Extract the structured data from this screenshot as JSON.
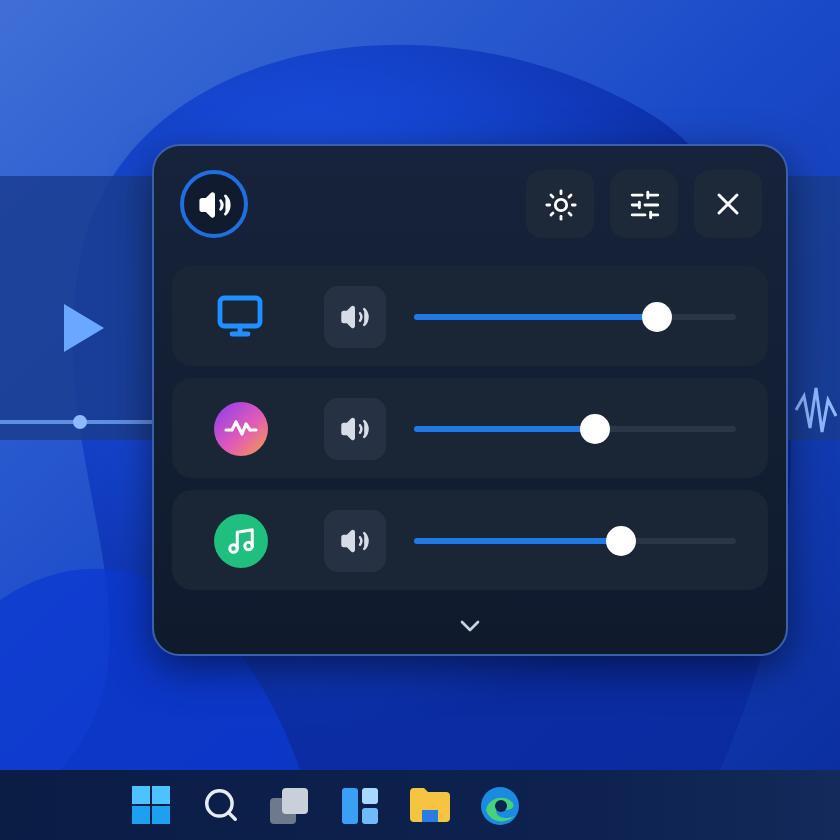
{
  "channels": [
    {
      "kind": "display",
      "level": 0.75
    },
    {
      "kind": "app",
      "level": 0.56
    },
    {
      "kind": "music",
      "level": 0.64
    }
  ]
}
